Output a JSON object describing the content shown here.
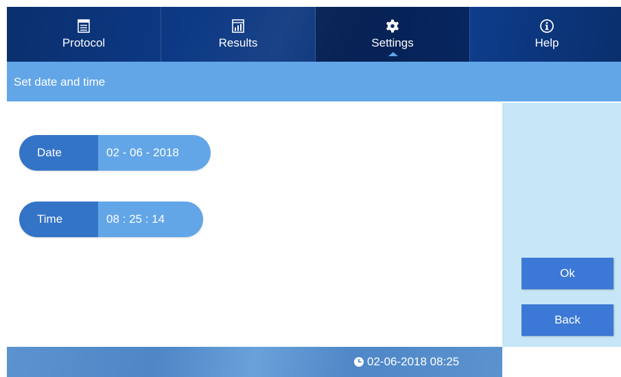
{
  "nav": {
    "tabs": [
      {
        "label": "Protocol",
        "icon": "window-icon"
      },
      {
        "label": "Results",
        "icon": "bar-chart-icon"
      },
      {
        "label": "Settings",
        "icon": "gear-icon"
      },
      {
        "label": "Help",
        "icon": "info-icon"
      }
    ],
    "active": "Settings"
  },
  "subheader": {
    "title": "Set date and time"
  },
  "fields": {
    "date": {
      "label": "Date",
      "value": "02 - 06 - 2018"
    },
    "time": {
      "label": "Time",
      "value": "08 : 25 : 14"
    }
  },
  "actions": {
    "ok_label": "Ok",
    "back_label": "Back"
  },
  "status": {
    "datetime": "02-06-2018 08:25",
    "icon": "clock-icon"
  },
  "colors": {
    "nav_bg": "#0b3479",
    "accent": "#62a6e8",
    "label_bg": "#3474c7",
    "button": "#3c78d6",
    "side_panel": "#c6e6f7"
  }
}
